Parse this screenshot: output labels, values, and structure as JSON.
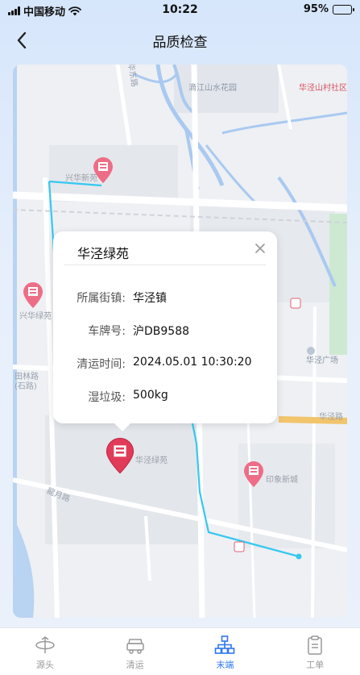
{
  "status_bar": {
    "carrier": "中国移动",
    "time": "10:22",
    "battery": "95%",
    "battery_level": 0.95
  },
  "nav": {
    "title": "品质检查"
  },
  "map": {
    "labels": {
      "park": "滴江山水花园",
      "community": "华泾山村社区",
      "road_top": "华东路",
      "road_bottom": "龍月路",
      "plaza": "华泾广场",
      "road_right": "华泾路",
      "left_small": "田林路",
      "left_small2": "(石路)"
    },
    "pois": [
      {
        "label": "兴华新苑"
      },
      {
        "label": "兴华绿苑"
      },
      {
        "label": "华泾绿苑"
      },
      {
        "label": "印象新城"
      }
    ],
    "route_color": "#35c8f0",
    "pin_color": "#e23b5a"
  },
  "popup": {
    "title": "华泾绿苑",
    "rows": [
      {
        "key": "所属街镇:",
        "value": "华泾镇"
      },
      {
        "key": "车牌号:",
        "value": "沪DB9588"
      },
      {
        "key": "清运时间:",
        "value": "2024.05.01 10:30:20"
      },
      {
        "key": "湿垃圾:",
        "value": "500kg"
      }
    ]
  },
  "tabs": [
    {
      "label": "源头",
      "active": false
    },
    {
      "label": "清运",
      "active": false
    },
    {
      "label": "末端",
      "active": true
    },
    {
      "label": "工单",
      "active": false
    }
  ],
  "colors": {
    "accent": "#2f76f0",
    "route": "#35c8f0",
    "pin": "#e23b5a"
  }
}
